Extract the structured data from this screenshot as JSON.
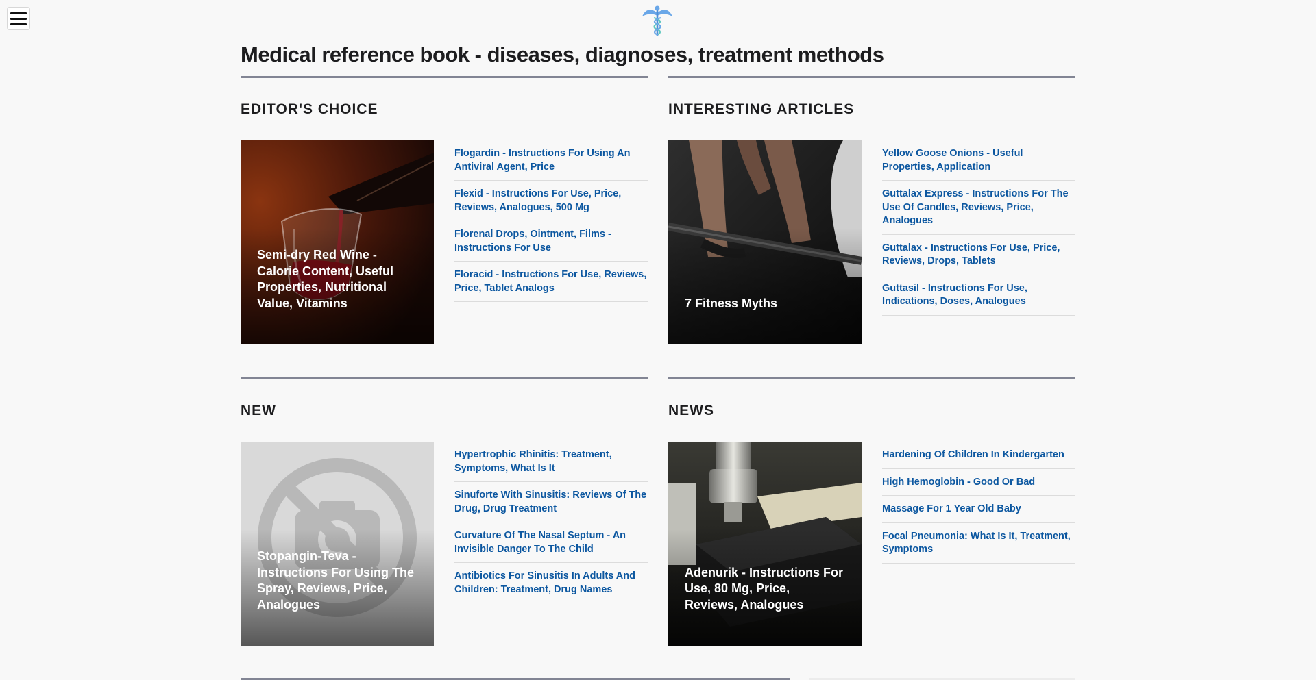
{
  "header": {
    "menu_icon": "hamburger-menu-icon",
    "logo_icon": "caduceus-icon",
    "logo_color": "#6aa7e8"
  },
  "page": {
    "title": "Medical reference book - diseases, diagnoses, treatment methods"
  },
  "sections": [
    {
      "title": "EDITOR'S CHOICE",
      "feature": {
        "title": "Semi-dry Red Wine - Calorie Content, Useful Properties, Nutritional Value, Vitamins",
        "image": "red-wine-pouring-image"
      },
      "links": [
        "Flogardin - Instructions For Using An Antiviral Agent, Price",
        "Flexid - Instructions For Use, Price, Reviews, Analogues, 500 Mg",
        "Florenal Drops, Ointment, Films - Instructions For Use",
        "Floracid - Instructions For Use, Reviews, Price, Tablet Analogs"
      ]
    },
    {
      "title": "INTERESTING ARTICLES",
      "feature": {
        "title": "7 Fitness Myths",
        "image": "barbell-deadlift-image"
      },
      "links": [
        "Yellow Goose Onions - Useful Properties, Application",
        "Guttalax Express - Instructions For The Use Of Candles, Reviews, Price, Analogues",
        "Guttalax - Instructions For Use, Price, Reviews, Drops, Tablets",
        "Guttasil - Instructions For Use, Indications, Doses, Analogues"
      ]
    },
    {
      "title": "NEW",
      "feature": {
        "title": "Stopangin-Teva - Instructions For Using The Spray, Reviews, Price, Analogues",
        "image": "no-photo-placeholder-image"
      },
      "links": [
        "Hypertrophic Rhinitis: Treatment, Symptoms, What Is It",
        "Sinuforte With Sinusitis: Reviews Of The Drug, Drug Treatment",
        "Curvature Of The Nasal Septum - An Invisible Danger To The Child",
        "Antibiotics For Sinusitis In Adults And Children: Treatment, Drug Names"
      ]
    },
    {
      "title": "NEWS",
      "feature": {
        "title": "Adenurik - Instructions For Use, 80 Mg, Price, Reviews, Analogues",
        "image": "microscope-image"
      },
      "links": [
        "Hardening Of Children In Kindergarten",
        "High Hemoglobin - Good Or Bad",
        "Massage For 1 Year Old Baby",
        "Focal Pneumonia: What Is It, Treatment, Symptoms"
      ]
    }
  ],
  "colors": {
    "link": "#0c57a0",
    "section_rule": "#828594",
    "background": "#f8f8f8"
  }
}
